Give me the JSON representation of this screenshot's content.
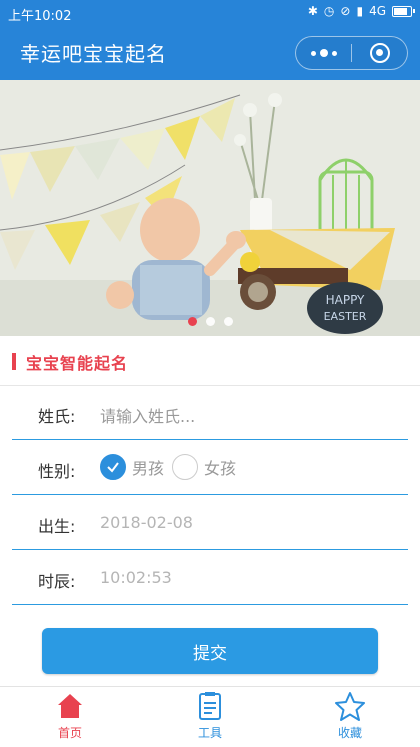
{
  "status_bar": {
    "time": "上午10:02",
    "network": "4G",
    "icons": [
      "bluetooth-icon",
      "alarm-icon",
      "mute-icon",
      "signal-icon",
      "battery-icon"
    ]
  },
  "nav": {
    "title": "幸运吧宝宝起名",
    "capsule": [
      "more-dots-icon",
      "close-mini-program-icon"
    ]
  },
  "banner": {
    "sign_text_1": "HAPPY",
    "sign_text_2": "EASTER",
    "slides": 3,
    "active_slide": 1
  },
  "section": {
    "title": "宝宝智能起名"
  },
  "form": {
    "surname": {
      "label": "姓氏:",
      "placeholder": "请输入姓氏..."
    },
    "gender": {
      "label": "性别:",
      "options": [
        {
          "label": "男孩",
          "checked": true
        },
        {
          "label": "女孩",
          "checked": false
        }
      ]
    },
    "birth": {
      "label": "出生:",
      "value": "2018-02-08"
    },
    "hour": {
      "label": "时辰:",
      "value": "10:02:53"
    }
  },
  "submit_label": "提交",
  "tabbar": {
    "items": [
      {
        "label": "首页",
        "icon": "home-icon",
        "active": true
      },
      {
        "label": "工具",
        "icon": "tools-icon",
        "active": false
      },
      {
        "label": "收藏",
        "icon": "star-icon",
        "active": false
      }
    ]
  },
  "colors": {
    "primary": "#2784d8",
    "accent": "#e8424f",
    "button": "#2b9ae3",
    "underline": "#2c9be0"
  }
}
